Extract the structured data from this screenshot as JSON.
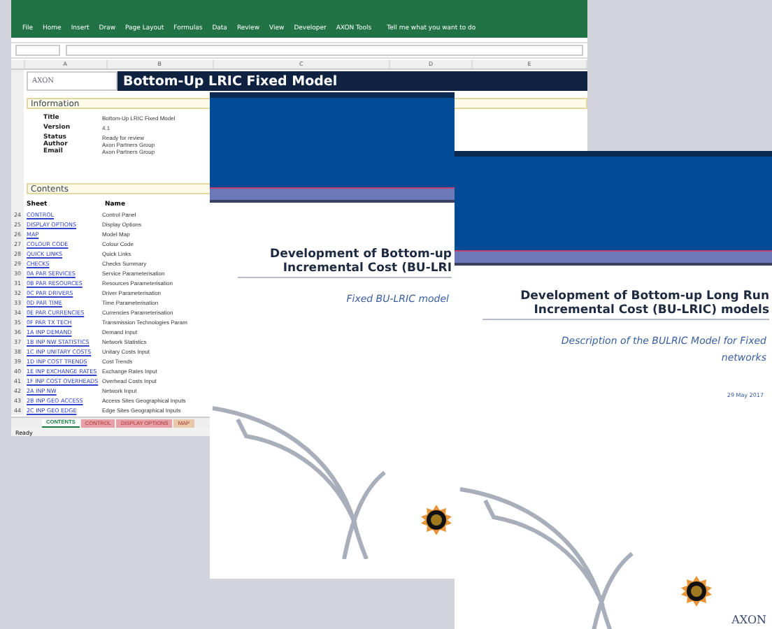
{
  "spreadsheet": {
    "ribbon_tabs": [
      "File",
      "Home",
      "Insert",
      "Draw",
      "Page Layout",
      "Formulas",
      "Data",
      "Review",
      "View",
      "Developer",
      "AXON Tools"
    ],
    "tell_me": "Tell me what you want to do",
    "columns": [
      "A",
      "B",
      "C",
      "D",
      "E"
    ],
    "logo_text": "AXON",
    "banner_title": "Bottom-Up LRIC Fixed Model",
    "information": {
      "heading": "Information",
      "fields": [
        {
          "label": "Title",
          "value": "Bottom-Up LRIC Fixed Model"
        },
        {
          "label": "Version",
          "value": "4.1"
        },
        {
          "label": "Status",
          "value": "Ready for review"
        },
        {
          "label": "Author",
          "value": "Axon Partners Group"
        },
        {
          "label": "Email",
          "value": "Axon Partners Group"
        }
      ]
    },
    "contents": {
      "heading": "Contents",
      "columns": [
        "Sheet",
        "Name"
      ],
      "rows": [
        {
          "row": "24",
          "sheet": "CONTROL",
          "name": "Control Panel"
        },
        {
          "row": "25",
          "sheet": "DISPLAY OPTIONS",
          "name": "Display Options"
        },
        {
          "row": "26",
          "sheet": "MAP",
          "name": "Model Map"
        },
        {
          "row": "27",
          "sheet": "COLOUR CODE",
          "name": "Colour Code"
        },
        {
          "row": "28",
          "sheet": "QUICK LINKS",
          "name": "Quick Links"
        },
        {
          "row": "29",
          "sheet": "CHECKS",
          "name": "Checks Summary"
        },
        {
          "row": "30",
          "sheet": "0A PAR SERVICES",
          "name": "Service Parameterisation"
        },
        {
          "row": "31",
          "sheet": "0B PAR RESOURCES",
          "name": "Resources Parameterisation"
        },
        {
          "row": "32",
          "sheet": "0C PAR DRIVERS",
          "name": "Driver Parameterisation"
        },
        {
          "row": "33",
          "sheet": "0D PAR TIME",
          "name": "Time Parameterisation"
        },
        {
          "row": "34",
          "sheet": "0E PAR CURRENCIES",
          "name": "Currencies Parameterisation"
        },
        {
          "row": "35",
          "sheet": "0F PAR TX TECH",
          "name": "Transmission Technologies Param"
        },
        {
          "row": "36",
          "sheet": "1A INP DEMAND",
          "name": "Demand Input"
        },
        {
          "row": "37",
          "sheet": "1B INP NW STATISTICS",
          "name": "Network Statistics"
        },
        {
          "row": "38",
          "sheet": "1C INP UNITARY COSTS",
          "name": "Unitary Costs Input"
        },
        {
          "row": "39",
          "sheet": "1D INP COST TRENDS",
          "name": "Cost Trends"
        },
        {
          "row": "40",
          "sheet": "1E INP EXCHANGE RATES",
          "name": "Exchange Rates Input"
        },
        {
          "row": "41",
          "sheet": "1F INP COST OVERHEADS",
          "name": "Overhead Costs Input"
        },
        {
          "row": "42",
          "sheet": "2A INP NW",
          "name": "Network Input"
        },
        {
          "row": "43",
          "sheet": "2B INP GEO ACCESS",
          "name": "Access Sites Geographical Inputs"
        },
        {
          "row": "44",
          "sheet": "2C INP GEO EDGE",
          "name": "Edge Sites Geographical Inputs"
        }
      ]
    },
    "sheet_tabs": [
      {
        "label": "CONTENTS",
        "selected": true,
        "color": "#ffffff"
      },
      {
        "label": "CONTROL",
        "selected": false,
        "color": "#e8a0a8"
      },
      {
        "label": "DISPLAY OPTIONS",
        "selected": false,
        "color": "#e8a0a8"
      },
      {
        "label": "MAP",
        "selected": false,
        "color": "#e8c8a8"
      }
    ],
    "status": "Ready"
  },
  "documents": [
    {
      "title_lines": [
        "Development of Bottom-up",
        "Incremental Cost (BU-LRI"
      ],
      "subtitle": "Fixed BU-LRIC model"
    },
    {
      "title_lines": [
        "Development of Bottom-up Long Run",
        "Incremental Cost (BU-LRIC) models"
      ],
      "subtitle": "Description of the BULRIC Model for Fixed networks",
      "date": "29 May 2017",
      "logo_text": "AXON"
    }
  ]
}
